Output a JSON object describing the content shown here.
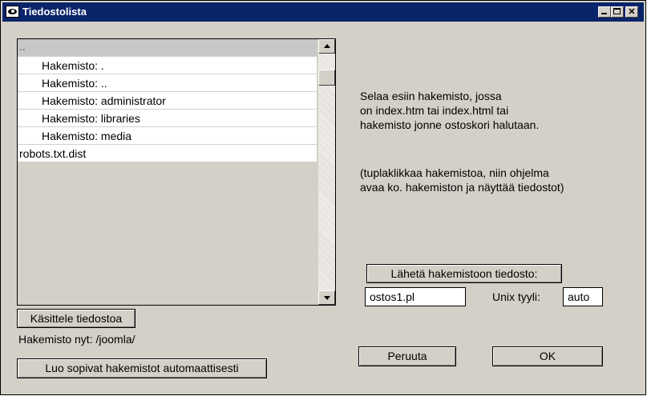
{
  "window": {
    "title": "Tiedostolista",
    "controls": [
      "minimize",
      "maximize",
      "close"
    ]
  },
  "file_list": {
    "items": [
      {
        "label": "..",
        "indent": false,
        "selected": true
      },
      {
        "label": "Hakemisto: .",
        "indent": true
      },
      {
        "label": "Hakemisto: ..",
        "indent": true
      },
      {
        "label": "Hakemisto: administrator",
        "indent": true
      },
      {
        "label": "Hakemisto: libraries",
        "indent": true
      },
      {
        "label": "Hakemisto: media",
        "indent": true
      },
      {
        "label": "robots.txt.dist",
        "indent": false
      }
    ]
  },
  "buttons": {
    "process_file": "Käsittele tiedostoa",
    "create_dirs": "Luo sopivat hakemistot automaattisesti",
    "send_file": "Lähetä hakemistoon tiedosto:",
    "cancel": "Peruuta",
    "ok": "OK"
  },
  "current_dir": "Hakemisto nyt: /joomla/",
  "instructions": {
    "line1": "Selaa esiin hakemisto, jossa",
    "line2": "on index.htm tai index.html tai",
    "line3": "hakemisto jonne ostoskori halutaan.",
    "hint1": "(tuplaklikkaa hakemistoa, niin ohjelma",
    "hint2": "avaa ko. hakemiston ja näyttää tiedostot)"
  },
  "send": {
    "filename": "ostos1.pl",
    "unix_label": "Unix tyyli:",
    "unix_value": "auto"
  }
}
